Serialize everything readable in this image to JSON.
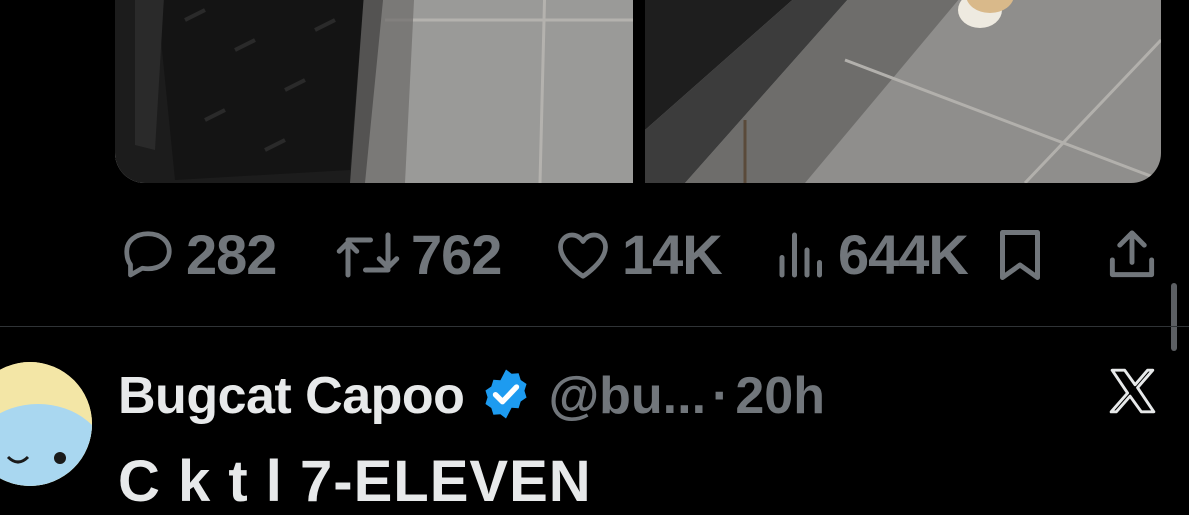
{
  "actions": {
    "replies": "282",
    "retweets": "762",
    "likes": "14K",
    "views": "644K"
  },
  "next_tweet": {
    "display_name": "Bugcat Capoo",
    "handle": "@bu...",
    "separator": "·",
    "time": "20h",
    "body_partial": "C         k  t l           7-ELEVEN"
  },
  "colors": {
    "background": "#000000",
    "muted_text": "#71767b",
    "primary_text": "#e7e9ea",
    "verified_badge": "#1d9bf0",
    "divider": "#2f3336"
  },
  "icons": {
    "reply": "reply-icon",
    "retweet": "retweet-icon",
    "like": "heart-icon",
    "views": "views-chart-icon",
    "bookmark": "bookmark-icon",
    "share": "share-icon",
    "verified": "verified-badge-icon",
    "source": "x-logo-icon"
  }
}
